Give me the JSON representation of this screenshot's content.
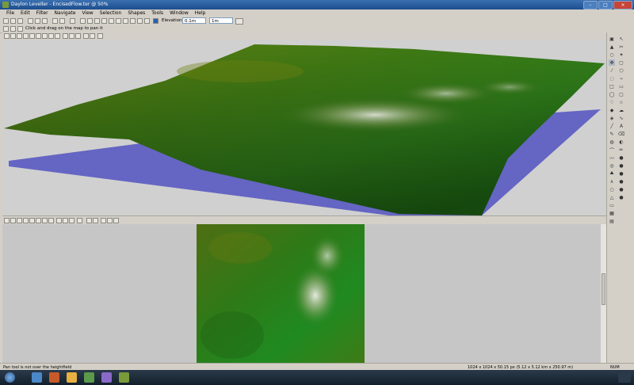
{
  "window": {
    "title": "Daylon Leveller - EncisedFlow.ter @ 50%"
  },
  "menu": [
    "File",
    "Edit",
    "Filter",
    "Navigate",
    "View",
    "Selection",
    "Shapes",
    "Tools",
    "Window",
    "Help"
  ],
  "toolbar": {
    "elev_label": "Elevations:",
    "elev_value": "0.1m",
    "elev_step": "1m"
  },
  "hint": "Click and drag on the map to pan it",
  "status": {
    "left": "Pan tool is not over the heightfield",
    "dims": "1024 x 1024 x 50.15 px (5.12 x 5.12 km x 250.97 m)",
    "num": "NUM"
  },
  "icons": {
    "close": "×",
    "minimize": "–",
    "maximize": "□"
  }
}
